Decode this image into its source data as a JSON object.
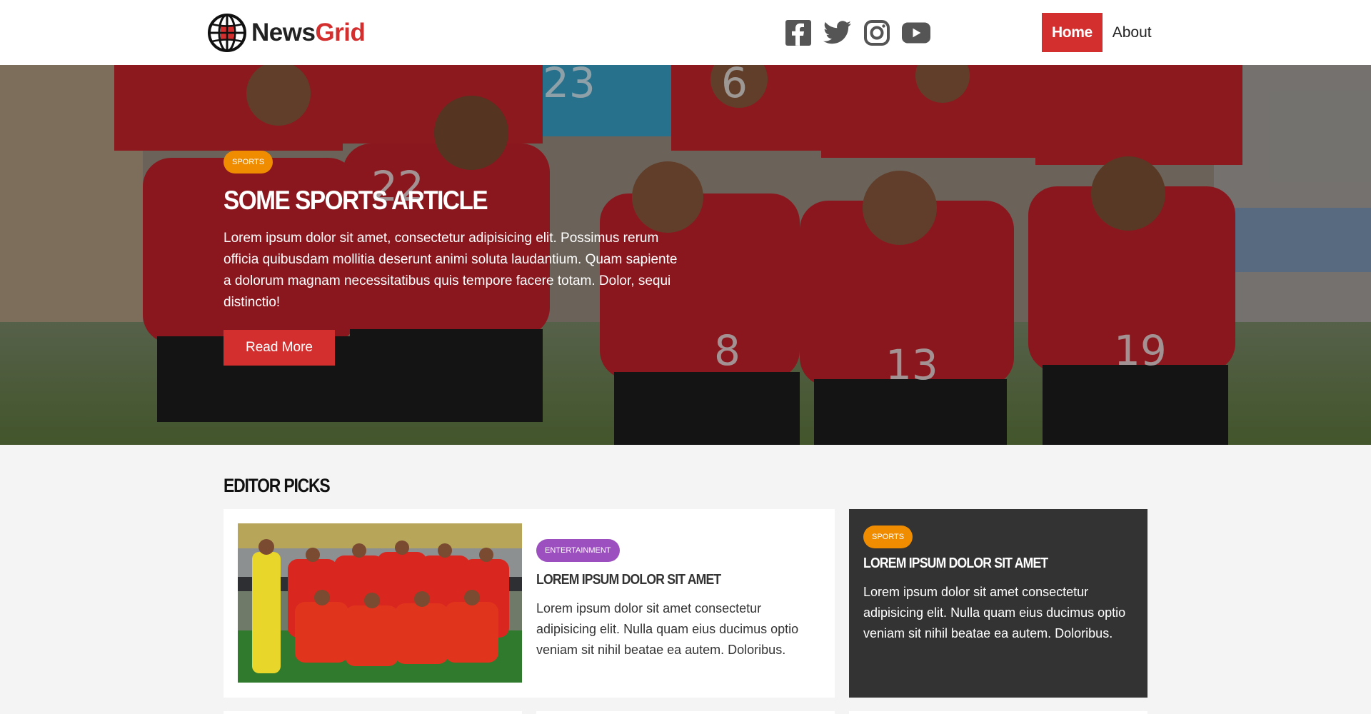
{
  "brand": {
    "logo_text_a": "News",
    "logo_text_b": "Grid",
    "logo_icon": "globe-icon"
  },
  "social": [
    {
      "icon": "facebook-icon"
    },
    {
      "icon": "twitter-icon"
    },
    {
      "icon": "instagram-icon"
    },
    {
      "icon": "youtube-icon"
    }
  ],
  "menu": {
    "home": "Home",
    "about": "About"
  },
  "hero": {
    "badge": "Sports",
    "title": "Some Sports Article",
    "text": "Lorem ipsum dolor sit amet, consectetur adipisicing elit. Possimus rerum officia quibusdam mollitia deserunt animi soluta laudantium. Quam sapiente a dolorum magnam necessitatibus quis tempore facere totam. Dolor, sequi distinctio!",
    "button": "Read More"
  },
  "editor_picks": {
    "title": "Editor Picks",
    "main_card": {
      "badge": "Entertainment",
      "title": "Lorem ipsum dolor sit amet",
      "text": "Lorem ipsum dolor sit amet consectetur adipisicing elit. Nulla quam eius ducimus optio veniam sit nihil beatae ea autem. Doloribus."
    },
    "side_card": {
      "badge": "Sports",
      "title": "Lorem ipsum dolor sit amet",
      "text": "Lorem ipsum dolor sit amet consectetur adipisicing elit. Nulla quam eius ducimus optio veniam sit nihil beatae ea autem. Doloribus."
    }
  },
  "colors": {
    "accent": "#d32f2f",
    "badge_sports": "#f08c00",
    "badge_entertainment": "#9c4fbf",
    "dark_card": "#333333"
  }
}
